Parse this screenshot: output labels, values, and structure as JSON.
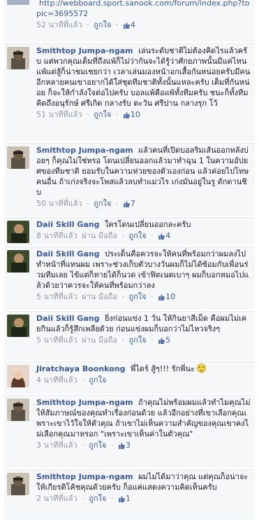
{
  "ui": {
    "like_label": "ถูกใจ",
    "via_label": "ผ่าน มือถือ",
    "separator": "·"
  },
  "comments": [
    {
      "author": "",
      "text": "",
      "link": "http://webboard.sport.sanook.com/forum/index.php?topic=3695572",
      "time": "52 นาทีที่แล้ว",
      "likes": "4"
    },
    {
      "author": "Smithtop Jumpa-ngam",
      "text": "เล่นระดับชาติไม่ต้องคิดไรแล้วครับ แต่พวกคุณเต็มที่ถึงแพ้ก็ไม่ว่ากันจะได้รู้ว่าศักยภาพนั้นมีแค่ไหน แพ้แต่สู้ก็น่าชมเชยกว่า เวลาเล่นมองหน้าอกเสื้อกันหน่อยครับมีคนอีกหลายคนเขาอยากได้ใส่ชุดทีมชาติทั้งนั้นแหละครับ เต็มที่กันหน่อย ก็จะให้กำลังใจต่อไปครับ บอลแพ้คือแพ้ทั้งทีมครับ ชนะก็ทั้งทีมคิดถึงอนุรักษ์ ศรีเกิด กลางรับ ตะวัน ศรีปาน กลางรุก โว้",
      "time": "51 นาทีที่แล้ว",
      "likes": "10"
    },
    {
      "author": "Smithtop Jumpa-ngam",
      "text": "แล้วคนที่เปิดบอลริมเส้นออกหลังบ่อยๆ ก็คุณไม่ใช่หรอ โดนเปลี่ยนออกแล้วมาทำฉุน 1 ในความอัปยศของทีมชาติ ยอมรับในความห่วยของตัวเองก่อน แล้วค่อยไปโทษคนอื่น ถ้าเก่งจริงจะโพสแล้วลบทำแม่วไร เก่งมันอยู่ในรู ดักดานชิบ",
      "time": "50 นาทีที่แล้ว",
      "likes": "7"
    },
    {
      "author": "Daii Skill Gang",
      "text": "ใครโดนเปลี่ยนออกละครับ",
      "time": "8 นาทีที่แล้ว",
      "via": true,
      "likes": "4"
    },
    {
      "author": "Daii Skill Gang",
      "text": "ประเด็นคือควรจะให้คนที่พร้อมกว่าผมลงไปทำหน้าที่แทนผม เพราะช่วงเก็บตัวบางวันผมก็ไม่ได้ซ้อมกับเพื่อนร่วมทีมเลย ไข้แต่ก็หายได้ก็นวด เข้าฟิตเนตเบาๆ ผมก็บอกหมอไปแล้วด้วยว่าควรจะให้คนที่พร้อมกว่าลง",
      "time": "5 นาทีที่แล้ว",
      "via": true,
      "likes": "10"
    },
    {
      "author": "Daii Skill Gang",
      "text": "ยิ่งก่อนแข่ง 1 วัน ให้กินยาสีเม็ด คือผมไม่เคยกินแล้วก็รู้สึกเพลียด้วย ก่อนแข่งผมก็บอกว่าไม่ไหวจริงๆ",
      "time": "5 นาทีที่แล้ว",
      "via": true,
      "likes": "5"
    },
    {
      "author": "Jiratchaya Boonkong",
      "text": "พี่ไดร์ สู้ๆ!!! รักพี่นะ",
      "time": "4 นาทีที่แล้ว",
      "smile": true
    },
    {
      "author": "Smithtop Jumpa-ngam",
      "text": "ถ้าคุณไม่พร้อมผมแล้วทำไมคุณไม่ให้สัมภาษณ์ของคุณทำเรื่องก่อนด้วย แล้วอีกอย่างที่เขาเลือกคุณเพราะเขาไว้ใจให้ตัวคุณ ถ้าเขาไม่เห็นความสำคัญของคุณเขาคงไม่เลือกคุณมาหรอก \"เพราะเขาเห็นค่าในตัวคุณ\"",
      "time": "3 นาทีที่แล้ว",
      "likes": "3"
    },
    {
      "author": "Smithtop Jumpa-ngam",
      "text": "ผมไม่ได้มาว่าคุณ แต่คุณก็อน่าจะให้เกียรติโค้ชคุณด้วยครับ ก็อแค่แสดงความคิดเห็นครับ",
      "time": "2 นาทีที่แล้ว",
      "likes": "1"
    }
  ],
  "colors": {
    "link": "#3b5998",
    "meta": "#9197a3",
    "bg": "#f6f7f9",
    "text": "#141823"
  },
  "icons": {
    "like": "thumbs-up-icon",
    "emoticon": "smile-emoticon-icon"
  }
}
